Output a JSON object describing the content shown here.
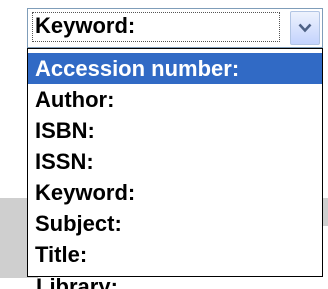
{
  "select": {
    "value": "Keyword:",
    "options": [
      "Accession number:",
      "Author:",
      "ISBN:",
      "ISSN:",
      "Keyword:",
      "Subject:",
      "Title:"
    ],
    "highlighted_index": 0,
    "button_icon": "chevron-down-icon"
  },
  "background": {
    "partial_text": "Library:",
    "partial_char": "("
  },
  "colors": {
    "highlight": "#316ac5",
    "border": "#7f9db9",
    "background_gray": "#cfcfcf"
  }
}
